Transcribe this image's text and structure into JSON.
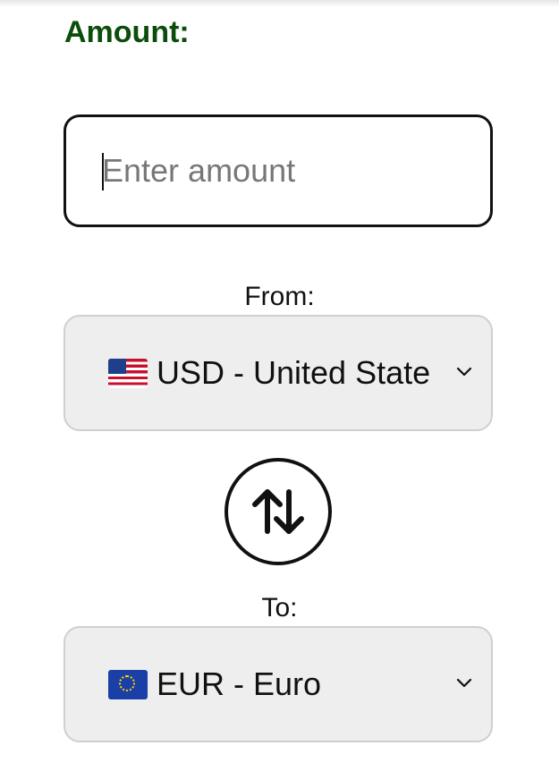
{
  "colors": {
    "amount_label": "#0b4d0b",
    "text": "#111111",
    "placeholder": "#777777",
    "select_bg": "#eeeeee",
    "select_border": "#cfcfcf"
  },
  "amount": {
    "label": "Amount:",
    "placeholder": "Enter amount",
    "value": ""
  },
  "from": {
    "label": "From:",
    "selected": "USD - United States",
    "flag": "us-flag-icon"
  },
  "swap": {
    "icon": "swap-arrows-icon"
  },
  "to": {
    "label": "To:",
    "selected": "EUR - Euro",
    "flag": "eu-flag-icon"
  }
}
